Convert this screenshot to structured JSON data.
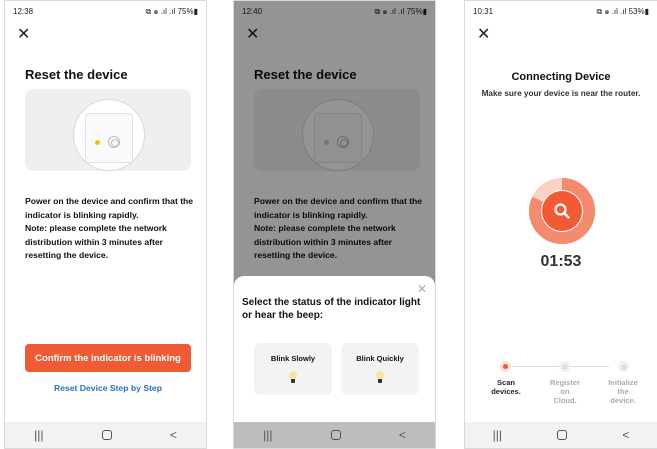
{
  "screen1": {
    "status_time": "12:38",
    "status_right": "⧉ ๑ .ıl .ıl 75%▮",
    "close_glyph": "✕",
    "title": "Reset the device",
    "instructions": "Power on the device and confirm that the indicator is blinking rapidly.\nNote: please complete the network distribution within 3 minutes after resetting the device.",
    "confirm_button": "Confirm the indicator is blinking",
    "step_link": "Reset Device Step by Step"
  },
  "screen2": {
    "status_time": "12:40",
    "status_right": "⧉ ๑ .ıl .ıl 75%▮",
    "close_glyph": "✕",
    "title": "Reset the device",
    "instructions": "Power on the device and confirm that the indicator is blinking rapidly.\nNote: please complete the network distribution within 3 minutes after resetting the device.",
    "sheet_close": "✕",
    "sheet_title": "Select the status of the indicator light or hear the beep:",
    "options": [
      {
        "label": "Blink Slowly"
      },
      {
        "label": "Blink Quickly"
      }
    ]
  },
  "screen3": {
    "status_time": "10:31",
    "status_right": "⧉ ๑ .ıl .ıl 53%▮",
    "close_glyph": "✕",
    "title": "Connecting Device",
    "subtitle": "Make sure your device is near the router.",
    "timer": "01:53",
    "progress_fraction": 0.82,
    "steps": [
      {
        "label": "Scan\ndevices.",
        "state": "active"
      },
      {
        "label": "Register\non\nCloud.",
        "state": "inactive"
      },
      {
        "label": "Initialize\nthe\ndevice.",
        "state": "inactive"
      }
    ]
  },
  "nav": {
    "recents": "|||",
    "back": "<"
  },
  "colors": {
    "accent": "#f05a35",
    "link": "#2c6fba",
    "led": "#f2c400"
  }
}
